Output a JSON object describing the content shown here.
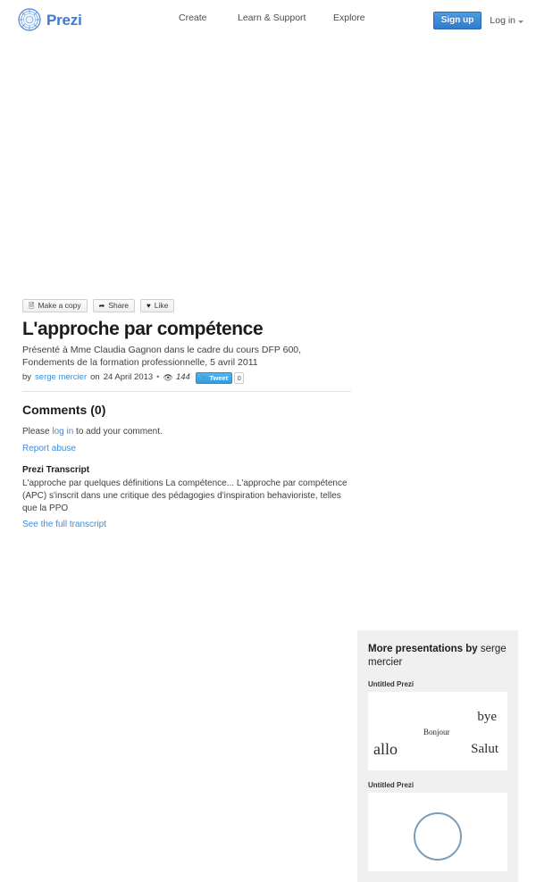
{
  "header": {
    "brand": {
      "name": "Prezi",
      "icon": "prezi-logo-icon",
      "color": "#3a7bd5"
    },
    "nav": [
      {
        "label": "Create",
        "name": "nav-create"
      },
      {
        "label": "Learn & Support",
        "name": "nav-learn-support"
      },
      {
        "label": "Explore",
        "name": "nav-explore"
      }
    ],
    "signup_label": "Sign up",
    "login_label": "Log in",
    "signup_color": "#2f7ccc"
  },
  "toolbar": {
    "make_copy_label": "Make a copy",
    "make_copy_icon": "copy-icon",
    "share_label": "Share",
    "share_icon": "share-icon",
    "like_label": "Like",
    "like_icon": "heart-icon"
  },
  "presentation": {
    "title": "L'approche par compétence",
    "description": "Présenté à Mme Claudia Gagnon dans le cadre du cours DFP 600, Fondements de la formation professionnelle, 5 avril 2011",
    "by_prefix": "by",
    "author": "serge mercier",
    "on_prefix": "on",
    "date": "24 April 2013",
    "separator": "•",
    "views_icon": "eye-icon",
    "views": "144",
    "tweet_label": "Tweet",
    "tweet_icon": "twitter-bird-icon",
    "tweet_count": "0"
  },
  "comments": {
    "heading": "Comments",
    "count": "(0)",
    "prompt_before": "Please",
    "login_link": "log in",
    "prompt_after": "to add your comment.",
    "report_abuse": "Report abuse"
  },
  "transcript": {
    "heading": "Prezi Transcript",
    "body": "L'approche par quelques définitions La compétence... L'approche par compétence (APC) s'inscrit dans une critique des pédagogies d'inspiration behavioriste, telles que la PPO",
    "link": "See the full transcript"
  },
  "sidebar": {
    "heading_prefix": "More presentations by",
    "heading_author": "serge mercier",
    "background": "#f0f0f0",
    "items": [
      {
        "title": "Untitled Prezi",
        "thumb_type": "words",
        "words": [
          "bye",
          "Bonjour",
          "allo",
          "Salut"
        ]
      },
      {
        "title": "Untitled Prezi",
        "thumb_type": "circle",
        "words": []
      }
    ]
  }
}
